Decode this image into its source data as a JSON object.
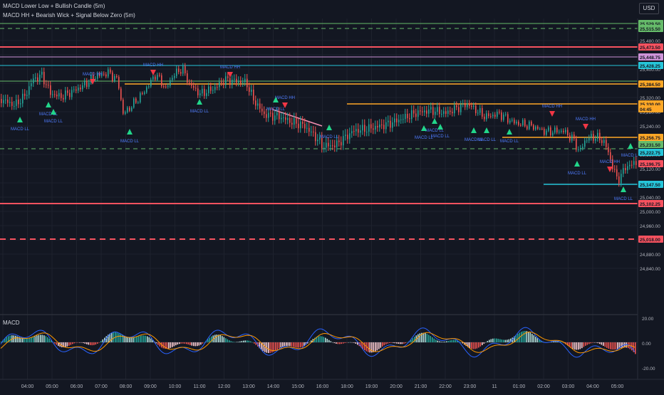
{
  "indicators": [
    "MACD Lower Low + Bullish Candle (5m)",
    "MACD HH + Bearish Wick + Signal Below Zero (5m)"
  ],
  "currency_button": "USD",
  "macd_pane_title": "MACD",
  "colors": {
    "background": "#131722",
    "grid": "#1e222d",
    "up": "#26a69a",
    "down": "#ef5350",
    "marker_up": "#22d68a",
    "marker_down": "#f23645",
    "signal_text": "#4f7cff",
    "macd_line": "#2962ff",
    "signal_line": "#ff9800"
  },
  "price_axis_labels": [
    "25,480.00",
    "25,440.00",
    "25,400.00",
    "25,360.00",
    "25,320.00",
    "25,280.00",
    "25,240.00",
    "25,200.00",
    "25,160.00",
    "25,120.00",
    "25,080.00",
    "25,040.00",
    "25,000.00",
    "24,960.00",
    "24,920.00",
    "24,880.00",
    "24,840.00"
  ],
  "price_badges": [
    {
      "text": "25,529.50",
      "color": "#66bb6a"
    },
    {
      "text": "25,515.50",
      "color": "#66bb6a"
    },
    {
      "text": "25,473.50",
      "color": "#f7525f"
    },
    {
      "text": "25,448.75",
      "color": "#ce93d8"
    },
    {
      "text": "25,428.25",
      "color": "#26c6da"
    },
    {
      "text": "25,384.50",
      "color": "#ffa726"
    },
    {
      "text": "25,330.00",
      "color": "#ffa726"
    },
    {
      "text": "04:45",
      "color": "#ffa726"
    },
    {
      "text": "25,256.75",
      "color": "#ffa726"
    },
    {
      "text": "25,231.50",
      "color": "#66bb6a"
    },
    {
      "text": "25,222.75",
      "color": "#26c6da"
    },
    {
      "text": "25,196.75",
      "color": "#f7525f"
    },
    {
      "text": "25,147.50",
      "color": "#26c6da"
    },
    {
      "text": "25,102.25",
      "color": "#f7525f"
    },
    {
      "text": "25,018.00",
      "color": "#f7525f"
    }
  ],
  "macd_axis_labels": [
    "20.00",
    "0.00",
    "-20.00"
  ],
  "time_labels": [
    "04:00",
    "05:00",
    "06:00",
    "07:00",
    "08:00",
    "09:00",
    "10:00",
    "11:00",
    "12:00",
    "13:00",
    "14:00",
    "15:00",
    "16:00",
    "18:00",
    "19:00",
    "20:00",
    "21:00",
    "22:00",
    "23:00",
    "11",
    "01:00",
    "02:00",
    "03:00",
    "04:00",
    "05:00"
  ],
  "signal_labels": [
    {
      "text": "MACD LL",
      "dir": "up"
    },
    {
      "text": "MACD LL",
      "dir": "up"
    },
    {
      "text": "MACD LL",
      "dir": "up"
    },
    {
      "text": "MACD LL",
      "dir": "up"
    },
    {
      "text": "MACD HH",
      "dir": "down"
    },
    {
      "text": "MACD HH",
      "dir": "down"
    },
    {
      "text": "MACD LL",
      "dir": "up"
    },
    {
      "text": "MACD HH",
      "dir": "down"
    },
    {
      "text": "MACD HH",
      "dir": "down"
    },
    {
      "text": "MACD LL",
      "dir": "up"
    },
    {
      "text": "MACD LL",
      "dir": "up"
    },
    {
      "text": "MACD LL",
      "dir": "up"
    },
    {
      "text": "MACD HH",
      "dir": "down"
    },
    {
      "text": "MACD HH",
      "dir": "down"
    },
    {
      "text": "MACD LL",
      "dir": "up"
    },
    {
      "text": "MACD LL",
      "dir": "up"
    },
    {
      "text": "MACD LL",
      "dir": "up"
    },
    {
      "text": "MACD LL",
      "dir": "up"
    },
    {
      "text": "MACD HH",
      "dir": "down"
    },
    {
      "text": "MACD LL",
      "dir": "up"
    },
    {
      "text": "MACD LL",
      "dir": "up"
    },
    {
      "text": "MACD LL",
      "dir": "up"
    },
    {
      "text": "MACD LL",
      "dir": "up"
    }
  ]
}
